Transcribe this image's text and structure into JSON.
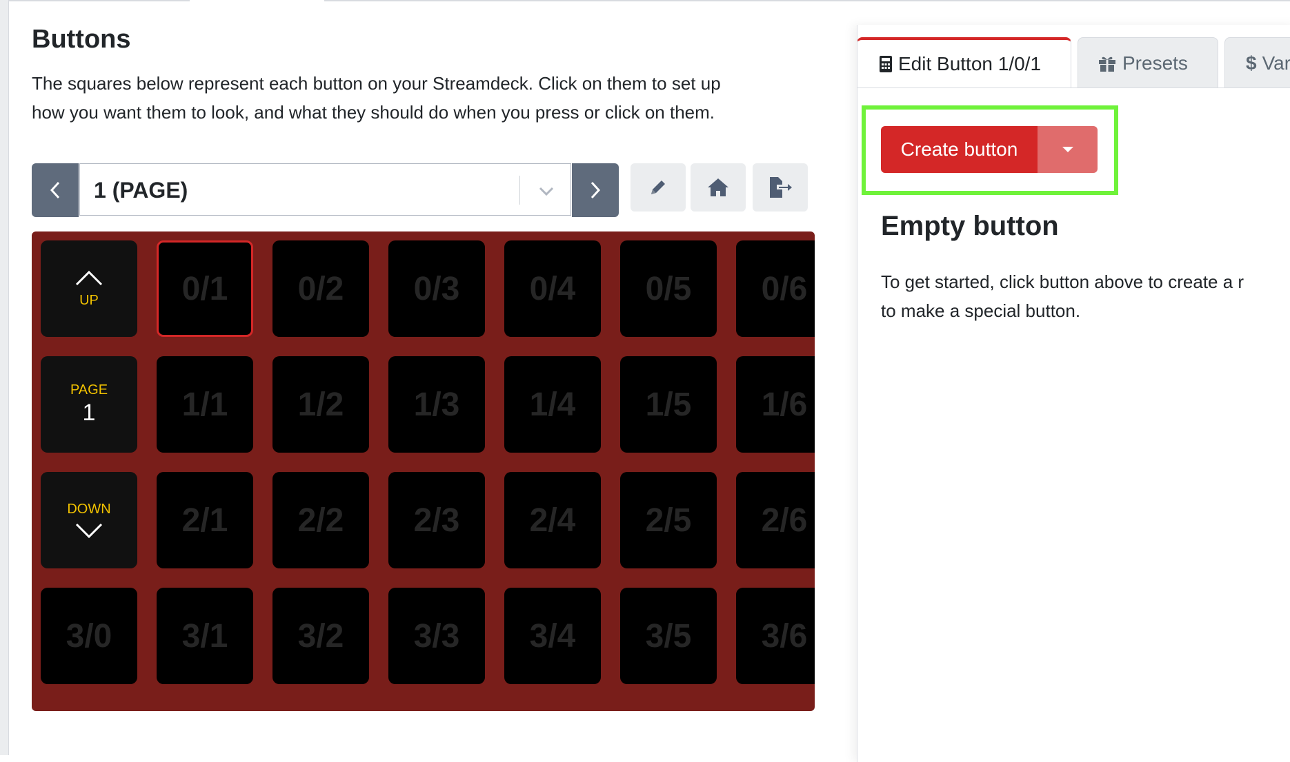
{
  "header": {
    "title": "Buttons",
    "description_line1": "The squares below represent each button on your Streamdeck. Click on them to set up",
    "description_line2": "how you want them to look, and what they should do when you press or click on them."
  },
  "page_nav": {
    "selected_page": "1 (PAGE)"
  },
  "grid": {
    "controls": {
      "up_label": "UP",
      "page_label": "PAGE",
      "page_number": "1",
      "down_label": "DOWN"
    },
    "rows": [
      [
        "0/1",
        "0/2",
        "0/3",
        "0/4",
        "0/5",
        "0/6"
      ],
      [
        "1/1",
        "1/2",
        "1/3",
        "1/4",
        "1/5",
        "1/6"
      ],
      [
        "2/1",
        "2/2",
        "2/3",
        "2/4",
        "2/5",
        "2/6"
      ],
      [
        "3/0",
        "3/1",
        "3/2",
        "3/3",
        "3/4",
        "3/5",
        "3/6"
      ]
    ],
    "selected": "0/1"
  },
  "panel": {
    "tabs": [
      {
        "label": "Edit Button 1/0/1",
        "icon": "calculator-icon",
        "active": true
      },
      {
        "label": "Presets",
        "icon": "gift-icon",
        "active": false
      },
      {
        "label": "Var",
        "icon": "dollar-icon",
        "active": false
      }
    ],
    "create_button_label": "Create button",
    "empty_title": "Empty button",
    "empty_text_line1": "To get started, click button above to create a r",
    "empty_text_line2": "to make a special button."
  },
  "colors": {
    "grid_background": "#791e1a",
    "accent_red": "#d42727",
    "nav_button": "#5f6b7c",
    "highlight_green": "#6ff23a",
    "control_label_yellow": "#f2c200"
  }
}
